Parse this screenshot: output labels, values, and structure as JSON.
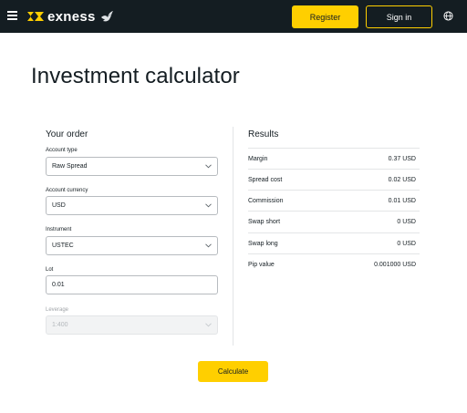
{
  "header": {
    "brand": "exness",
    "register_label": "Register",
    "signin_label": "Sign in"
  },
  "page_title": "Investment calculator",
  "order": {
    "title": "Your order",
    "account_type": {
      "label": "Account type",
      "value": "Raw Spread"
    },
    "account_currency": {
      "label": "Account currency",
      "value": "USD"
    },
    "instrument": {
      "label": "Instrument",
      "value": "USTEC"
    },
    "lot": {
      "label": "Lot",
      "value": "0.01"
    },
    "leverage": {
      "label": "Leverage",
      "value": "1:400"
    }
  },
  "results": {
    "title": "Results",
    "rows": [
      {
        "label": "Margin",
        "value": "0.37 USD"
      },
      {
        "label": "Spread cost",
        "value": "0.02 USD"
      },
      {
        "label": "Commission",
        "value": "0.01 USD"
      },
      {
        "label": "Swap short",
        "value": "0 USD"
      },
      {
        "label": "Swap long",
        "value": "0 USD"
      },
      {
        "label": "Pip value",
        "value": "0.001000 USD"
      }
    ]
  },
  "calculate_label": "Calculate",
  "colors": {
    "topbar": "#141d22",
    "accent": "#ffcf00"
  }
}
